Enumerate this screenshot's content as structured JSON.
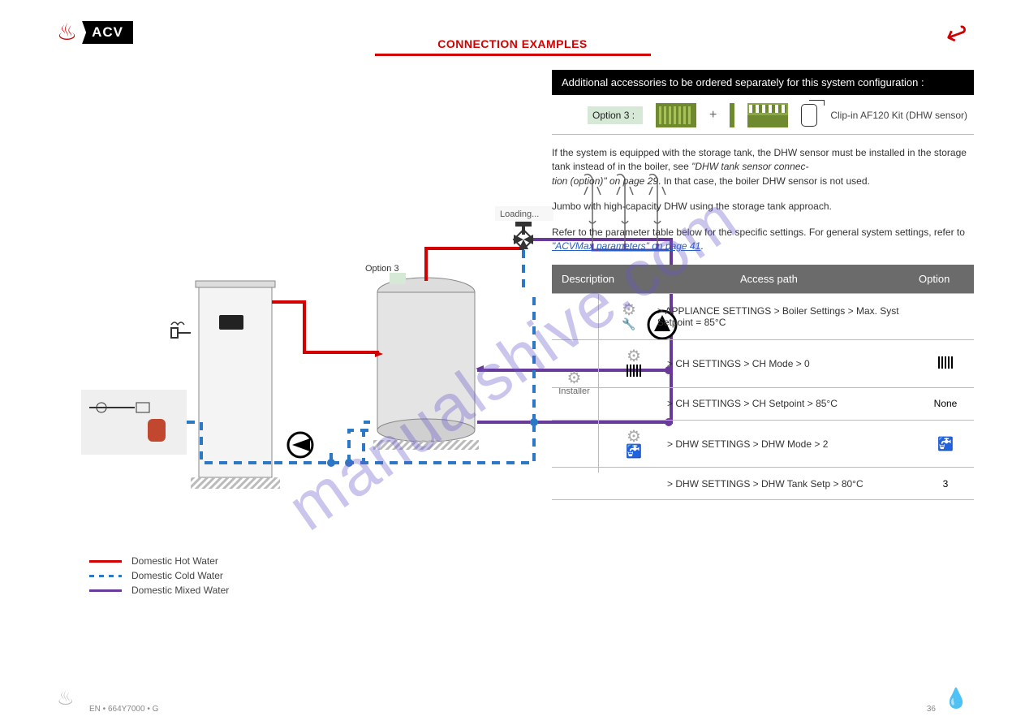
{
  "header": {
    "brand": "ACV",
    "page_title": "CONNECTION EXAMPLES"
  },
  "right": {
    "black_bar": "Additional accessories to be ordered separately for this system configuration :",
    "opt_label": "Option 3 :",
    "opt_kit": "Clip-in AF120 Kit (DHW sensor)",
    "para1_a": "If the system is equipped with the storage tank, the DHW sensor must be installed in the storage tank instead of in the boiler, see",
    "para1_link": "\"DHW tank sensor connec-",
    "para1_b": "",
    "para2_a": "tion (option)\" on page 29",
    "para2_b": ". In that case, the boiler DHW sensor is not used.",
    "para3": "Jumbo with high-capacity DHW using the storage tank approach.",
    "para4_a": "Refer to the parameter table below for the specific settings. For general system settings, refer to ",
    "para4_link": "\"ACVMax parameters\" on page 41",
    "para4_b": ".",
    "grey_cols": {
      "desc": "Description",
      "path": "Access path",
      "opt": "Option"
    },
    "rows": [
      {
        "desc": "Installer",
        "path": "> APPLIANCE SETTINGS > Boiler Settings > Max. Syst Setpoint = 85°C",
        "opt": "",
        "icon_desc": "gear-screw",
        "icon_path": "gear-screw"
      },
      {
        "desc": "",
        "path": "> CH SETTINGS > CH Mode > 0",
        "opt": "",
        "icon_path": "gear-rad",
        "opt_icon": "rad"
      },
      {
        "desc": "",
        "path": "> CH SETTINGS > CH Setpoint > 85°C",
        "opt": "None",
        "icon_path": ""
      },
      {
        "desc": "",
        "path": "> DHW SETTINGS > DHW Mode > 2",
        "opt": "",
        "icon_path": "gear-tap",
        "opt_icon": "tap"
      },
      {
        "desc": "",
        "path": "> DHW SETTINGS > DHW Tank Setp > 80°C",
        "opt": "3",
        "icon_path": ""
      }
    ]
  },
  "diagram": {
    "loading_label": "Loading...",
    "opt3": "Option 3"
  },
  "legend": {
    "hot": "Domestic Hot Water",
    "cold": "Domestic Cold Water",
    "mix": "Domestic Mixed Water"
  },
  "footer": {
    "doc": "EN • 664Y7000 • G",
    "page": "36"
  },
  "watermark": "manualshive.com"
}
